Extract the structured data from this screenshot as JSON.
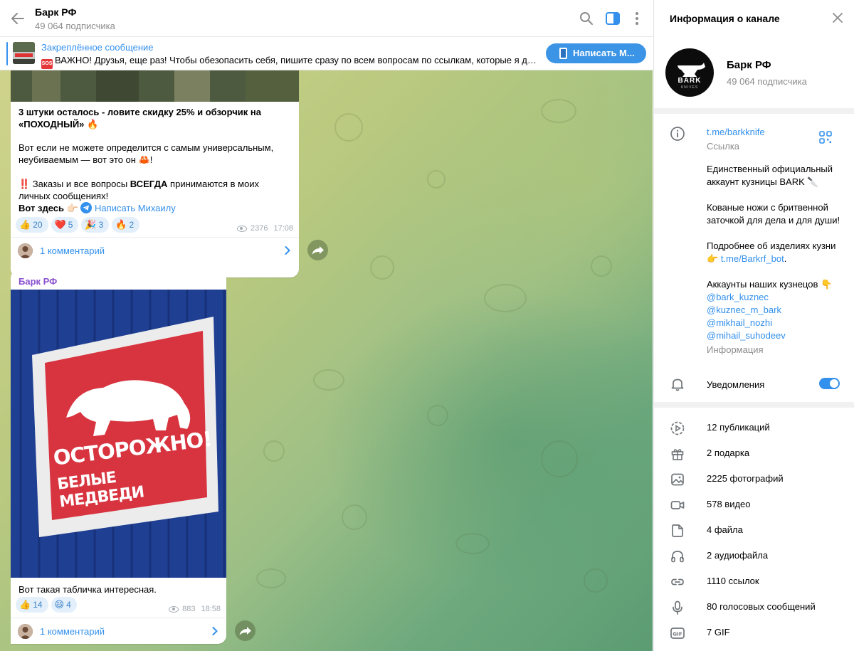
{
  "header": {
    "title": "Барк РФ",
    "subscribers": "49 064 подписчика"
  },
  "pinned": {
    "title": "Закреплённое сообщение",
    "text": "ВАЖНО! Друзья, еще раз! Чтобы обезопасить себя, пишите сразу по всем вопросам по ссылкам, которые я даю в...",
    "badge": "SOS",
    "button": "Написать М..."
  },
  "messages": [
    {
      "text_bold": "3 штуки осталось - ловите скидку 25% и обзорчик на «ПОХОДНЫЙ» 🔥",
      "text_1": "Вот если не можете определится с самым универсальным, неубиваемым — вот это он 🦀!",
      "text_2_prefix": "‼️ Заказы и все вопросы ",
      "text_2_bold": "ВСЕГДА",
      "text_2_suffix": " принимаются в моих личных сообщениях!",
      "text_3_bold": "Вот здесь 👉🏻",
      "link": "Написать Михаилу",
      "reactions": [
        {
          "emoji": "👍",
          "count": "20"
        },
        {
          "emoji": "❤️",
          "count": "5"
        },
        {
          "emoji": "🎉",
          "count": "3"
        },
        {
          "emoji": "🔥",
          "count": "2"
        }
      ],
      "views": "2376",
      "time": "17:08",
      "comments": "1 комментарий"
    },
    {
      "author": "Барк РФ",
      "sign_line1": "ОСТОРОЖНО!",
      "sign_line2": "БЕЛЫЕ МЕДВЕДИ",
      "caption": "Вот такая табличка интересная.",
      "reactions": [
        {
          "emoji": "👍",
          "count": "14"
        },
        {
          "emoji": "😄",
          "count": "4"
        }
      ],
      "views": "883",
      "time": "18:58",
      "comments": "1 комментарий"
    }
  ],
  "info_panel": {
    "title": "Информация о канале",
    "channel_name": "Барк РФ",
    "subscribers": "49 064 подписчика",
    "avatar_text": "BARK",
    "avatar_sub": "KNIVES",
    "link": "t.me/barkknife",
    "link_label": "Ссылка",
    "desc_1": "Единственный официальный аккаунт кузницы BARK 🔪",
    "desc_2": "Кованые ножи с бритвенной заточкой для дела и для души!",
    "desc_3": "Подробнее об изделиях кузни",
    "desc_3_link": "t.me/Barkrf_bot",
    "desc_4": "Аккаунты наших кузнецов 👇",
    "accounts": [
      "@bark_kuznec",
      "@kuznec_m_bark",
      "@mikhail_nozhi",
      "@mihail_suhodeev"
    ],
    "info_label": "Информация",
    "notifications": "Уведомления",
    "notifications_on": true,
    "media": [
      {
        "icon": "publications-icon",
        "label": "12 публикаций"
      },
      {
        "icon": "gift-icon",
        "label": "2 подарка"
      },
      {
        "icon": "photo-icon",
        "label": "2225 фотографий"
      },
      {
        "icon": "video-icon",
        "label": "578 видео"
      },
      {
        "icon": "file-icon",
        "label": "4 файла"
      },
      {
        "icon": "headphones-icon",
        "label": "2 аудиофайла"
      },
      {
        "icon": "link-icon",
        "label": "1110 ссылок"
      },
      {
        "icon": "microphone-icon",
        "label": "80 голосовых сообщений"
      },
      {
        "icon": "gif-icon",
        "label": "7 GIF"
      }
    ]
  },
  "colors": {
    "accent": "#3390ec",
    "author": "#8a4fcf",
    "reaction_bg": "#e3effb",
    "sign_red": "#d8343f",
    "wall_blue": "#1f3f93"
  }
}
